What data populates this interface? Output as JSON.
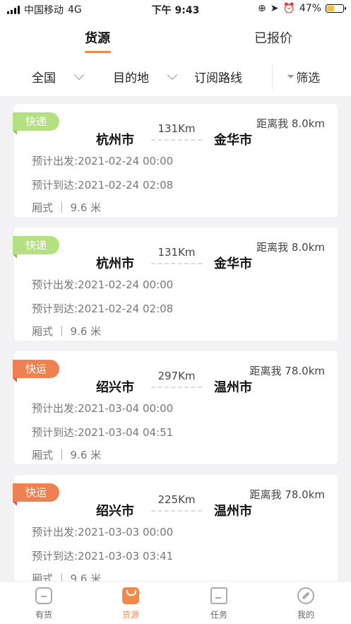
{
  "status_bar": {
    "carrier": "中国移动",
    "network": "4G",
    "time": "下午 9:43",
    "battery": "47%"
  },
  "tabs": [
    {
      "label": "货源",
      "active": true
    },
    {
      "label": "已报价",
      "active": false
    }
  ],
  "filters": {
    "region": "全国",
    "destination": "目的地",
    "subscription": "订阅路线",
    "filter_label": "筛选"
  },
  "cards": [
    {
      "type": "快递",
      "type_color": "#b5e082",
      "distance": "距离我 8.0km",
      "from": "杭州市",
      "to": "金华市",
      "km": "131Km",
      "departure": "预计出发:2021-02-24 00:00",
      "arrival": "预计到达:2021-02-24 02:08",
      "body": "厢式 ｜ 9.6 米"
    },
    {
      "type": "快递",
      "type_color": "#b5e082",
      "distance": "距离我 8.0km",
      "from": "杭州市",
      "to": "金华市",
      "km": "131Km",
      "departure": "预计出发:2021-02-24 00:00",
      "arrival": "预计到达:2021-02-24 02:08",
      "body": "厢式 ｜ 9.6 米"
    },
    {
      "type": "快运",
      "type_color": "#ee8051",
      "distance": "距离我 78.0km",
      "from": "绍兴市",
      "to": "温州市",
      "km": "297Km",
      "departure": "预计出发:2021-03-04 00:00",
      "arrival": "预计到达:2021-03-04 04:51",
      "body": "厢式 ｜ 9.6 米"
    },
    {
      "type": "快运",
      "type_color": "#ee8051",
      "distance": "距离我 78.0km",
      "from": "绍兴市",
      "to": "温州市",
      "km": "225Km",
      "departure": "预计出发:2021-03-03 00:00",
      "arrival": "预计到达:2021-03-03 03:41",
      "body": "厢式 ｜ 9.6 米"
    }
  ],
  "tabbar": [
    {
      "label": "有货",
      "icon": "home-icon",
      "active": false
    },
    {
      "label": "货源",
      "icon": "bag-icon",
      "active": true
    },
    {
      "label": "任务",
      "icon": "document-icon",
      "active": false
    },
    {
      "label": "我的",
      "icon": "compass-icon",
      "active": false
    }
  ]
}
